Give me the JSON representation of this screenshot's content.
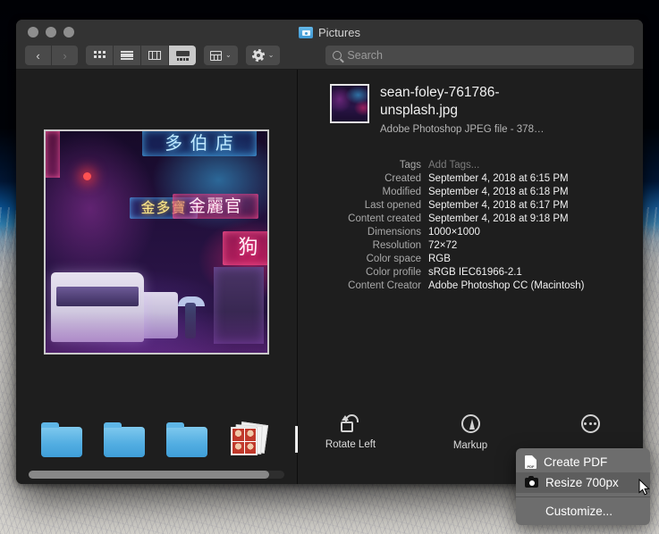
{
  "window": {
    "title": "Pictures",
    "title_icon": "folder-camera-icon",
    "traffic_lights": [
      "close",
      "minimize",
      "zoom"
    ]
  },
  "toolbar": {
    "back_label": "‹",
    "forward_label": "›",
    "view_modes": [
      {
        "name": "icon-view",
        "label": "Icon View"
      },
      {
        "name": "list-view",
        "label": "List View"
      },
      {
        "name": "column-view",
        "label": "Column View"
      },
      {
        "name": "gallery-view",
        "label": "Gallery View",
        "active": true
      }
    ],
    "arrange_label": "Arrange",
    "action_label": "Action",
    "chevron": "⌄"
  },
  "search": {
    "placeholder": "Search",
    "value": "",
    "icon": "search-icon"
  },
  "gallery": {
    "thumbnails": [
      {
        "name": "folder-thumbnail",
        "kind": "folder"
      },
      {
        "name": "folder-thumbnail",
        "kind": "folder"
      },
      {
        "name": "folder-thumbnail",
        "kind": "folder"
      },
      {
        "name": "photobooth-thumbnail",
        "kind": "photobooth"
      },
      {
        "name": "photos-thumbnail",
        "kind": "photos"
      }
    ],
    "preview_signs": {
      "top": "多 伯 店",
      "mid_left": "金多寶",
      "mid_right": "金麗官",
      "right": "狗"
    }
  },
  "file": {
    "name": "sean-foley-761786-unsplash.jpg",
    "kind": "Adobe Photoshop JPEG file - 378…"
  },
  "metadata": [
    {
      "label": "Tags",
      "value": "Add Tags...",
      "placeholder": true
    },
    {
      "label": "Created",
      "value": "September 4, 2018 at 6:15 PM"
    },
    {
      "label": "Modified",
      "value": "September 4, 2018 at 6:18 PM"
    },
    {
      "label": "Last opened",
      "value": "September 4, 2018 at 6:17 PM"
    },
    {
      "label": "Content created",
      "value": "September 4, 2018 at 9:18 PM"
    },
    {
      "label": "Dimensions",
      "value": "1000×1000"
    },
    {
      "label": "Resolution",
      "value": "72×72"
    },
    {
      "label": "Color space",
      "value": "RGB"
    },
    {
      "label": "Color profile",
      "value": "sRGB IEC61966-2.1"
    },
    {
      "label": "Content Creator",
      "value": "Adobe Photoshop CC (Macintosh)"
    }
  ],
  "actions": [
    {
      "name": "rotate-left",
      "label": "Rotate Left",
      "icon": "rotate-left-icon"
    },
    {
      "name": "markup",
      "label": "Markup",
      "icon": "markup-icon"
    },
    {
      "name": "more",
      "label": "",
      "icon": "ellipsis-icon"
    }
  ],
  "popup_menu": {
    "items": [
      {
        "label": "Create PDF",
        "icon": "pdf-icon",
        "selected": false
      },
      {
        "label": "Resize 700px",
        "icon": "camera-icon",
        "selected": true
      },
      {
        "label": "Customize...",
        "icon": "",
        "selected": false
      }
    ]
  },
  "colors": {
    "window_chrome": "#333333",
    "window_body": "#1e1e1e",
    "toolbar_button": "#4a4a4a",
    "menu_background": "#6d6d6d",
    "menu_highlight": "#5d5d5d",
    "folder_blue": "#53aee2",
    "text_primary": "#f1f1f1",
    "text_secondary": "#a9a9a9"
  }
}
